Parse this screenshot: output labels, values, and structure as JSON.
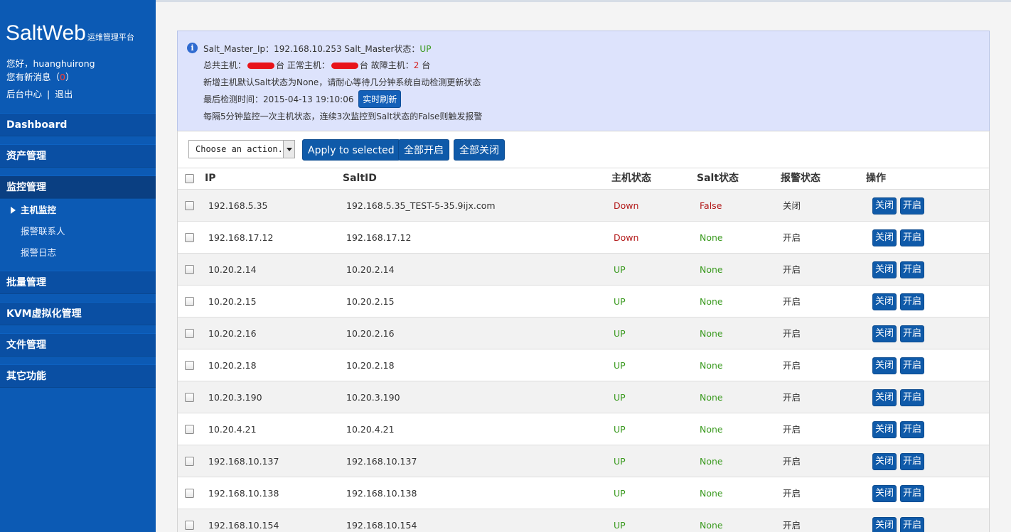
{
  "sidebar": {
    "brand": "SaltWeb",
    "brand_sub": "运维管理平台",
    "greeting": "您好，huanghuirong",
    "messages_prefix": "您有新消息（",
    "messages_count": "0",
    "messages_suffix": "）",
    "admin_link": "后台中心",
    "separator": "|",
    "logout_link": "退出",
    "nav": {
      "dashboard": "Dashboard",
      "assets": "资产管理",
      "monitor": "监控管理",
      "batch": "批量管理",
      "kvm": "KVM虚拟化管理",
      "files": "文件管理",
      "other": "其它功能"
    },
    "sub": {
      "host_monitor": "主机监控",
      "alert_contacts": "报警联系人",
      "alert_log": "报警日志"
    }
  },
  "info": {
    "master_ip_label": "Salt_Master_Ip：",
    "master_ip": "192.168.10.253",
    "master_state_label": "Salt_Master状态：",
    "master_state": "UP",
    "total_label": "总共主机：",
    "total_unit": "台",
    "normal_label": "正常主机：",
    "normal_unit": "台",
    "fault_label": "故障主机：",
    "fault_count": "2",
    "fault_unit": "台",
    "note1": "新增主机默认Salt状态为None，请耐心等待几分钟系统自动检测更新状态",
    "last_check_label": "最后检测时间：",
    "last_check": "2015-04-13 19:10:06",
    "refresh_button": "实时刷新",
    "note2": "每隔5分钟监控一次主机状态，连续3次监控到Salt状态的False则触发报警"
  },
  "toolbar": {
    "select_value": "Choose an action...",
    "apply_button": "Apply to selected",
    "enable_all": "全部开启",
    "disable_all": "全部关闭"
  },
  "table": {
    "headers": {
      "ip": "IP",
      "saltid": "SaltID",
      "host_state": "主机状态",
      "salt_state": "Salt状态",
      "alert_state": "报警状态",
      "ops": "操作"
    },
    "close_label": "关闭",
    "open_label": "开启",
    "rows": [
      {
        "ip": "192.168.5.35",
        "saltid": "192.168.5.35_TEST-5-35.9ijx.com",
        "host": "Down",
        "salt": "False",
        "alert": "关闭"
      },
      {
        "ip": "192.168.17.12",
        "saltid": "192.168.17.12",
        "host": "Down",
        "salt": "None",
        "alert": "开启"
      },
      {
        "ip": "10.20.2.14",
        "saltid": "10.20.2.14",
        "host": "UP",
        "salt": "None",
        "alert": "开启"
      },
      {
        "ip": "10.20.2.15",
        "saltid": "10.20.2.15",
        "host": "UP",
        "salt": "None",
        "alert": "开启"
      },
      {
        "ip": "10.20.2.16",
        "saltid": "10.20.2.16",
        "host": "UP",
        "salt": "None",
        "alert": "开启"
      },
      {
        "ip": "10.20.2.18",
        "saltid": "10.20.2.18",
        "host": "UP",
        "salt": "None",
        "alert": "开启"
      },
      {
        "ip": "10.20.3.190",
        "saltid": "10.20.3.190",
        "host": "UP",
        "salt": "None",
        "alert": "开启"
      },
      {
        "ip": "10.20.4.21",
        "saltid": "10.20.4.21",
        "host": "UP",
        "salt": "None",
        "alert": "开启"
      },
      {
        "ip": "192.168.10.137",
        "saltid": "192.168.10.137",
        "host": "UP",
        "salt": "None",
        "alert": "开启"
      },
      {
        "ip": "192.168.10.138",
        "saltid": "192.168.10.138",
        "host": "UP",
        "salt": "None",
        "alert": "开启"
      },
      {
        "ip": "192.168.10.154",
        "saltid": "192.168.10.154",
        "host": "UP",
        "salt": "None",
        "alert": "开启"
      }
    ]
  },
  "colors": {
    "sidebar_bg": "#0c5ab4",
    "button_blue": "#0f5aa9",
    "info_bg": "#dde3fc",
    "status_green": "#3a9a1f",
    "status_red": "#b21818"
  }
}
